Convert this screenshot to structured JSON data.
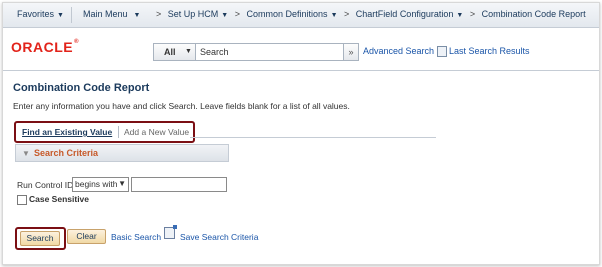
{
  "topnav": {
    "favorites": "Favorites",
    "main_menu": "Main Menu",
    "breadcrumbs": [
      "Set Up HCM",
      "Common Definitions",
      "ChartField Configuration",
      "Combination Code Report"
    ],
    "breadcrumb_sep": ">"
  },
  "header": {
    "logo": "ORACLE",
    "logo_mark": "®",
    "search_scope": "All",
    "search_placeholder": "Search",
    "go_symbol": "»",
    "advanced_search": "Advanced Search",
    "last_search_results": "Last Search Results"
  },
  "page": {
    "title": "Combination Code Report",
    "instructions": "Enter any information you have and click Search. Leave fields blank for a list of all values.",
    "tabs": [
      "Find an Existing Value",
      "Add a New Value"
    ]
  },
  "criteria": {
    "section_label": "Search Criteria",
    "run_control_label": "Run Control ID:",
    "operator": "begins with",
    "run_control_value": "",
    "case_sensitive_label": "Case Sensitive",
    "case_sensitive_checked": false
  },
  "actions": {
    "search": "Search",
    "clear": "Clear",
    "basic_search": "Basic Search",
    "save_search": "Save Search Criteria"
  },
  "colors": {
    "highlight_border": "#7b0f14",
    "link": "#1a55a8",
    "section_label": "#c75a2a",
    "brand_red": "#e2231a"
  }
}
